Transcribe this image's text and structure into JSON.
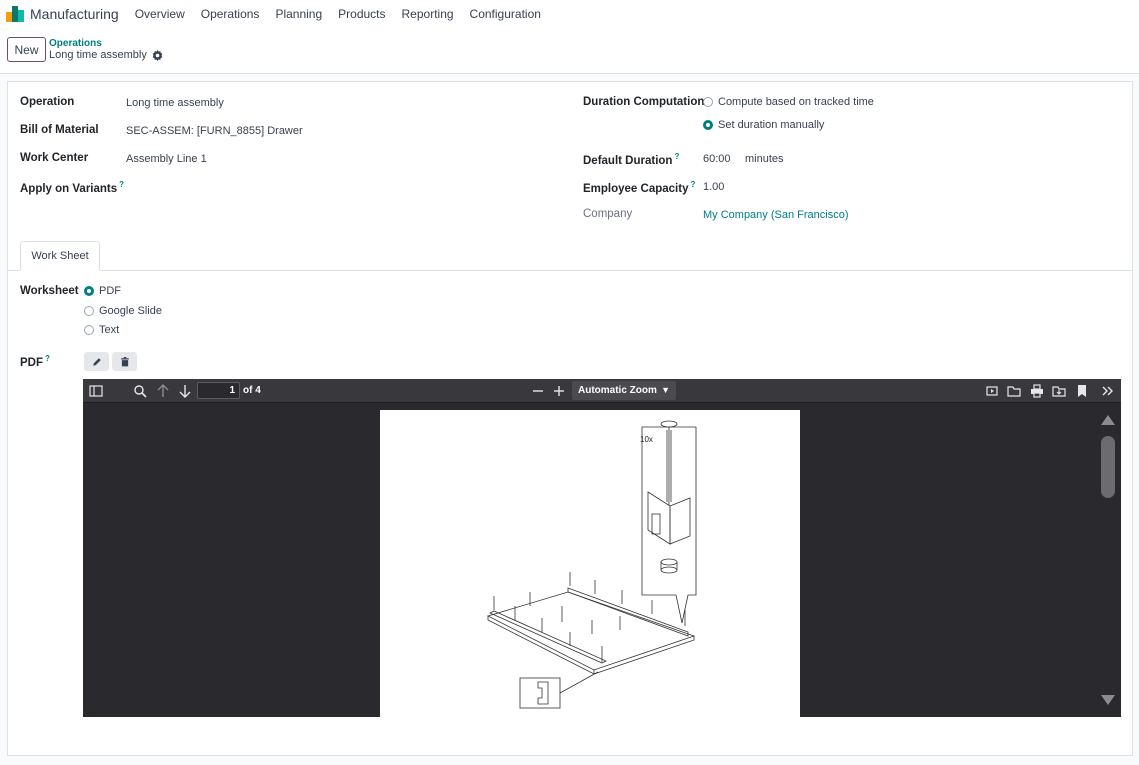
{
  "app": {
    "brand": "Manufacturing",
    "menu": [
      "Overview",
      "Operations",
      "Planning",
      "Products",
      "Reporting",
      "Configuration"
    ]
  },
  "control": {
    "new_label": "New",
    "breadcrumb_parent": "Operations",
    "breadcrumb_current": "Long time assembly"
  },
  "form": {
    "operation_label": "Operation",
    "operation_value": "Long time assembly",
    "bom_label": "Bill of Material",
    "bom_value": "SEC-ASSEM: [FURN_8855] Drawer",
    "workcenter_label": "Work Center",
    "workcenter_value": "Assembly Line 1",
    "variants_label": "Apply on Variants",
    "duration_comp_label": "Duration Computation",
    "duration_opt_tracked": "Compute based on tracked time",
    "duration_opt_manual": "Set duration manually",
    "default_duration_label": "Default Duration",
    "default_duration_value": "60:00",
    "default_duration_unit": "minutes",
    "capacity_label": "Employee Capacity",
    "capacity_value": "1.00",
    "company_label": "Company",
    "company_value": "My Company (San Francisco)",
    "help_mark": "?"
  },
  "tabs": [
    "Work Sheet"
  ],
  "worksheet": {
    "label": "Worksheet",
    "options": [
      "PDF",
      "Google Slide",
      "Text"
    ],
    "selected": "PDF",
    "pdf_label": "PDF"
  },
  "viewer": {
    "page_number": "1",
    "page_total": "of 4",
    "zoom": "Automatic Zoom",
    "drawing_label": "10x"
  },
  "colors": {
    "accent": "#017e84",
    "brand": "#714b67",
    "viewer_bg": "#2a2a2e",
    "viewer_toolbar": "#38383d"
  }
}
